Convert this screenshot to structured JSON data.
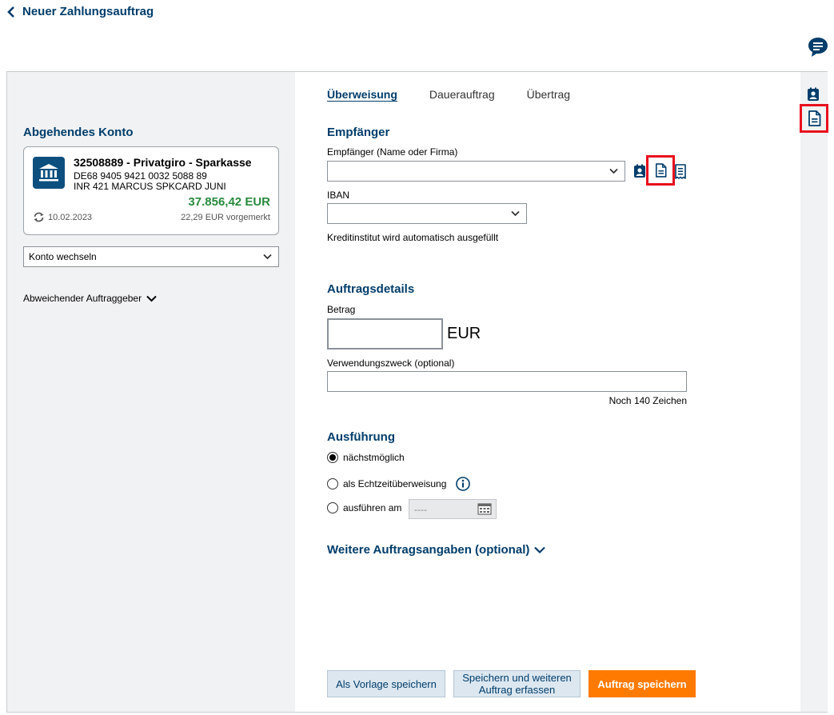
{
  "header": {
    "back_label": "Neuer Zahlungsauftrag"
  },
  "icons": {
    "chat": "chat-bubble-icon",
    "contacts": "address-book-icon",
    "template": "document-icon",
    "bill": "receipt-icon",
    "bank": "bank-building-icon",
    "sync": "sync-icon",
    "calendar": "calendar-icon",
    "info": "info-icon"
  },
  "colors": {
    "brand": "#003d6b",
    "balance_positive": "#2a8a3e",
    "primary_button": "#ff7a00",
    "highlight": "#e8101e"
  },
  "left": {
    "heading": "Abgehendes Konto",
    "account": {
      "title": "32508889 - Privatgiro - Sparkasse",
      "iban": "DE68 9405 9421 0032 5088 89",
      "owner": "INR 421 MARCUS SPKCARD JUNI",
      "balance": "37.856,42 EUR",
      "date": "10.02.2023",
      "reserved": "22,29 EUR vorgemerkt"
    },
    "switch_label": "Konto wechseln",
    "sender_toggle": "Abweichender Auftraggeber"
  },
  "tabs": [
    {
      "label": "Überweisung"
    },
    {
      "label": "Dauerauftrag"
    },
    {
      "label": "Übertrag"
    }
  ],
  "recipient": {
    "heading": "Empfänger",
    "name_label": "Empfänger (Name oder Firma)",
    "name_value": "",
    "iban_label": "IBAN",
    "iban_value": "",
    "bank_hint": "Kreditinstitut wird automatisch ausgefüllt"
  },
  "details": {
    "heading": "Auftragsdetails",
    "amount_label": "Betrag",
    "amount_value": "",
    "currency": "EUR",
    "purpose_label": "Verwendungszweck (optional)",
    "purpose_value": "",
    "chars_left": "Noch 140 Zeichen"
  },
  "execution": {
    "heading": "Ausführung",
    "options": [
      {
        "label": "nächstmöglich",
        "checked": true
      },
      {
        "label": "als Echtzeitüberweisung",
        "checked": false
      },
      {
        "label": "ausführen am",
        "checked": false
      }
    ],
    "date_placeholder": "----"
  },
  "more": {
    "label": "Weitere Auftragsangaben (optional)"
  },
  "buttons": {
    "template": "Als Vorlage speichern",
    "save_more_line1": "Speichern und weiteren",
    "save_more_line2": "Auftrag erfassen",
    "save": "Auftrag speichern"
  }
}
